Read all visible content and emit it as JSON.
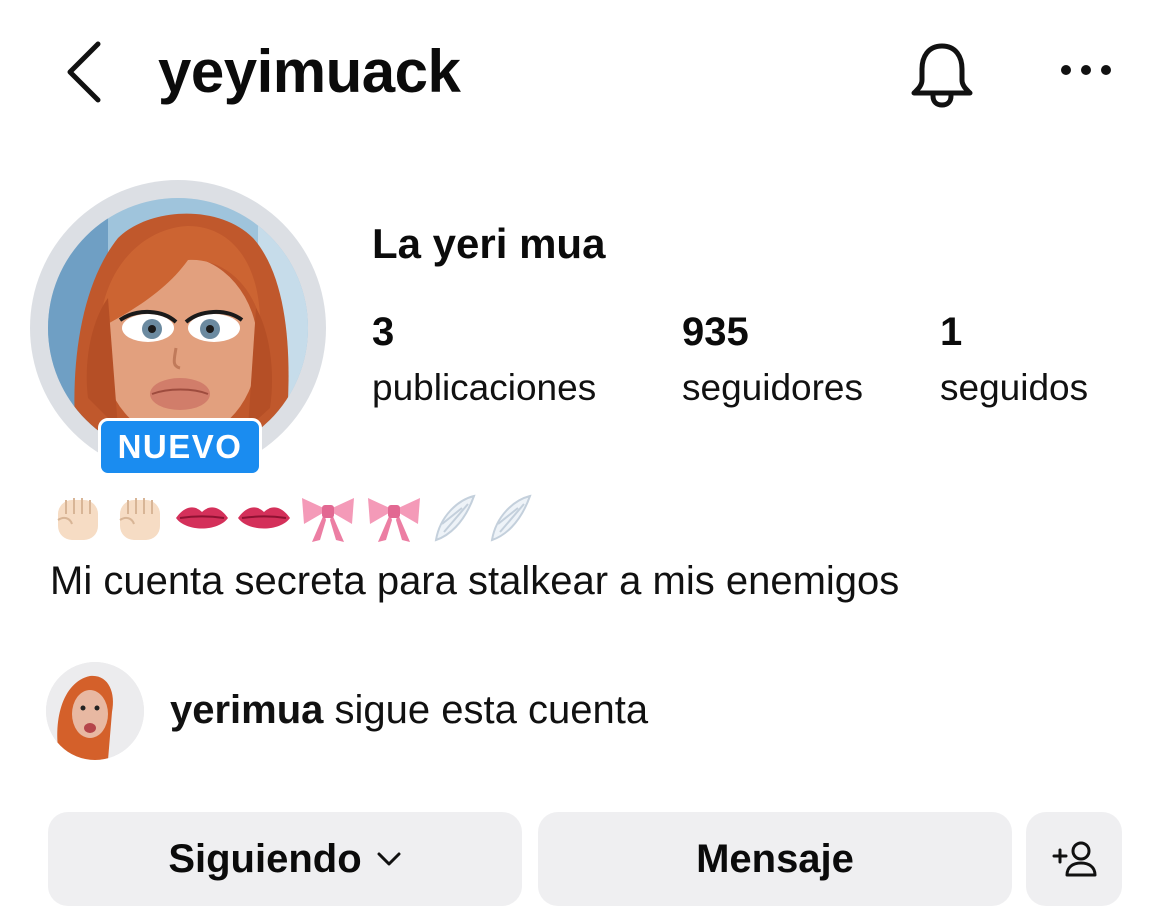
{
  "header": {
    "username": "yeyimuack",
    "icons": [
      "chevron-left-icon",
      "bell-icon",
      "more-horizontal-icon"
    ]
  },
  "profile": {
    "display_name": "La yeri mua",
    "badge": "NUEVO",
    "stats": {
      "posts": {
        "value": "3",
        "label": "publicaciones"
      },
      "followers": {
        "value": "935",
        "label": "seguidores"
      },
      "following": {
        "value": "1",
        "label": "seguidos"
      }
    },
    "bio_emojis": [
      "raised-fist",
      "raised-fist",
      "lips",
      "lips",
      "pink-bow",
      "pink-bow",
      "wing",
      "wing"
    ],
    "bio": "Mi cuenta secreta para stalkear a mis enemigos"
  },
  "followed_by": {
    "username": "yerimua",
    "text": "sigue esta cuenta"
  },
  "actions": {
    "following_label": "Siguiendo",
    "message_label": "Mensaje",
    "icons": [
      "chevron-down-icon",
      "add-person-icon"
    ]
  },
  "colors": {
    "badge_bg": "#1a8cf0",
    "button_bg": "#efeff1",
    "avatar_ring": "#dcdfe4"
  }
}
